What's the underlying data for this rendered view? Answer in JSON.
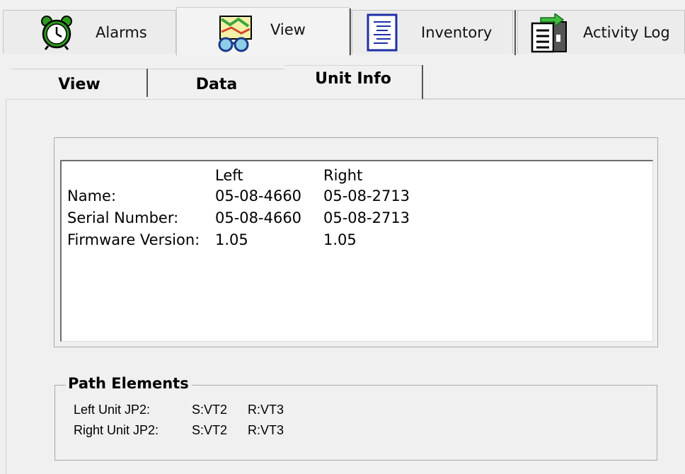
{
  "top_tabs": [
    {
      "label": "Alarms",
      "icon": "alarm-clock-icon",
      "active": false
    },
    {
      "label": "View",
      "icon": "map-view-icon",
      "active": true
    },
    {
      "label": "Inventory",
      "icon": "inventory-list-icon",
      "active": false
    },
    {
      "label": "Activity Log",
      "icon": "activity-log-icon",
      "active": false
    }
  ],
  "sub_tabs": [
    {
      "label": "View",
      "active": false
    },
    {
      "label": "Data",
      "active": false
    },
    {
      "label": "Unit Info",
      "active": true
    }
  ],
  "unit_info": {
    "headers": [
      "",
      "Left",
      "Right"
    ],
    "rows": [
      [
        "Name:",
        "05-08-4660",
        "05-08-2713"
      ],
      [
        "Serial Number:",
        "05-08-4660",
        "05-08-2713"
      ],
      [
        "Firmware Version:",
        "1.05",
        "1.05"
      ]
    ]
  },
  "path_elements": {
    "title": "Path Elements",
    "rows": [
      [
        "Left Unit JP2:",
        "S:VT2",
        "R:VT3"
      ],
      [
        "Right Unit JP2:",
        "S:VT2",
        "R:VT3"
      ]
    ]
  },
  "colors": {
    "background": "#f0f0f0",
    "alarm_green": "#2e9a1e",
    "inventory_blue": "#1f2fa8",
    "log_green": "#3fbf3f"
  }
}
